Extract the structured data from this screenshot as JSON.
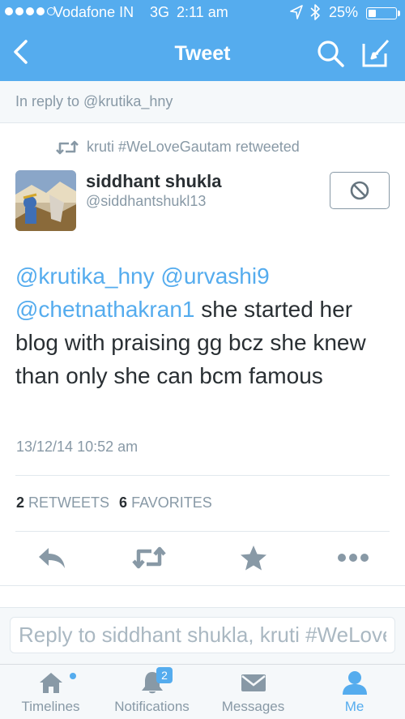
{
  "status_bar": {
    "carrier": "Vodafone IN",
    "network": "3G",
    "time": "2:11 am",
    "battery_percent": "25%",
    "battery_level": 0.25,
    "signal_icons": [
      "filled",
      "filled",
      "filled",
      "filled",
      "empty"
    ]
  },
  "nav": {
    "title": "Tweet",
    "back_icon": "chevron-left-icon",
    "search_icon": "search-icon",
    "compose_icon": "compose-icon"
  },
  "reply_context": "In reply to @krutika_hny",
  "retweet_line": "kruti #WeLoveGautam retweeted",
  "author": {
    "name": "siddhant shukla",
    "handle": "@siddhantshukl13"
  },
  "tweet": {
    "mentions": [
      "@krutika_hny",
      "@urvashi9",
      "@chetnathakran1"
    ],
    "body": " she started her blog with praising gg bcz she knew than only she can bcm famous",
    "timestamp": "13/12/14 10:52 am"
  },
  "stats": {
    "retweets_count": "2",
    "retweets_label": "RETWEETS",
    "favorites_count": "6",
    "favorites_label": "FAVORITES"
  },
  "reply_box": {
    "placeholder": "Reply to siddhant shukla, kruti #WeLoveGautam"
  },
  "tabs": [
    {
      "label": "Timelines",
      "icon": "home-icon"
    },
    {
      "label": "Notifications",
      "icon": "bell-icon",
      "badge": "2"
    },
    {
      "label": "Messages",
      "icon": "envelope-icon"
    },
    {
      "label": "Me",
      "icon": "person-icon",
      "active": true
    }
  ],
  "colors": {
    "accent": "#55acee",
    "muted": "#8899a6",
    "text": "#292f33"
  }
}
